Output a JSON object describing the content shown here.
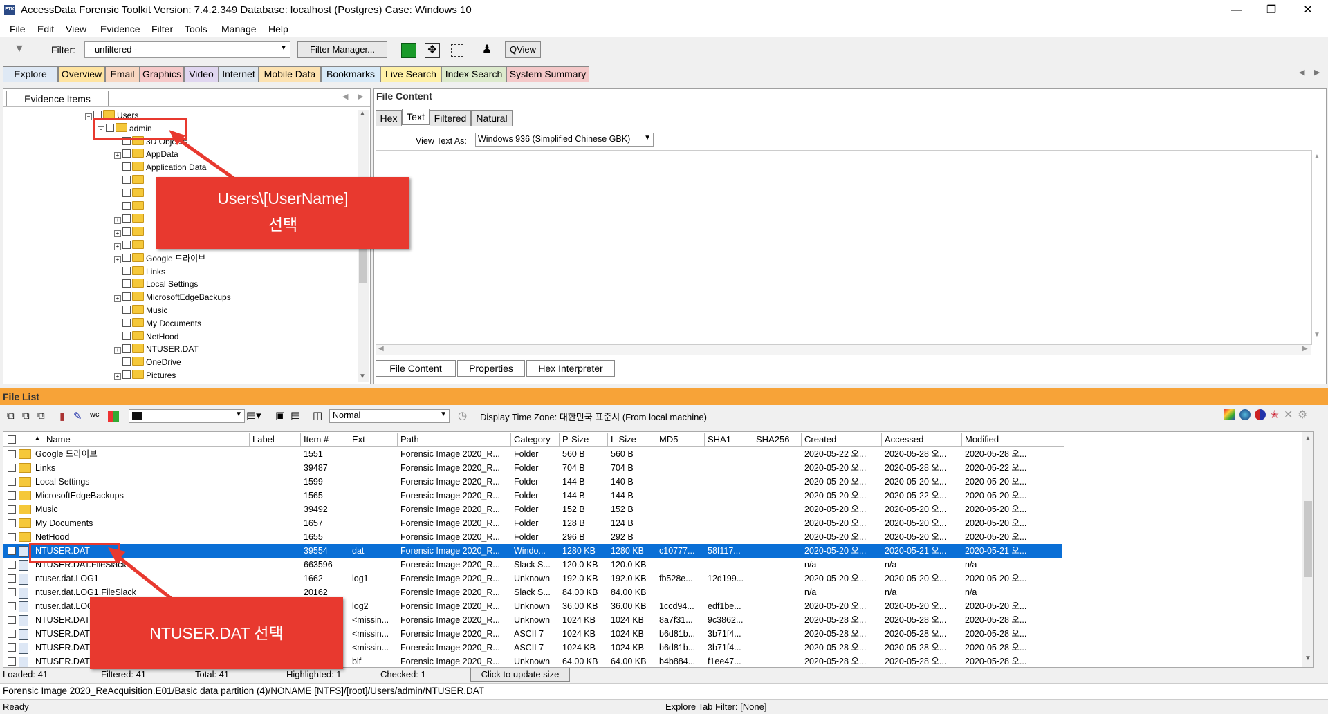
{
  "window": {
    "title": "AccessData Forensic Toolkit Version: 7.4.2.349 Database: localhost (Postgres) Case: Windows 10",
    "icon_text": "FTK"
  },
  "menu": [
    "File",
    "Edit",
    "View",
    "Evidence",
    "Filter",
    "Tools",
    "Manage",
    "Help"
  ],
  "toolbar": {
    "filter_label": "Filter:",
    "filter_value": "- unfiltered -",
    "filter_manager": "Filter Manager...",
    "qview": "QView"
  },
  "main_tabs": [
    "Explore",
    "Overview",
    "Email",
    "Graphics",
    "Video",
    "Internet",
    "Mobile Data",
    "Bookmarks",
    "Live Search",
    "Index Search",
    "System Summary"
  ],
  "evidence": {
    "tab": "Evidence Items",
    "tree": [
      {
        "label": "Users",
        "indent": 0,
        "exp": "−"
      },
      {
        "label": "admin",
        "indent": 1,
        "exp": "−"
      },
      {
        "label": "3D Objects",
        "indent": 2,
        "exp": ""
      },
      {
        "label": "AppData",
        "indent": 2,
        "exp": "+"
      },
      {
        "label": "Application Data",
        "indent": 2,
        "exp": ""
      },
      {
        "label": "",
        "indent": 2,
        "exp": ""
      },
      {
        "label": "",
        "indent": 2,
        "exp": ""
      },
      {
        "label": "",
        "indent": 2,
        "exp": ""
      },
      {
        "label": "",
        "indent": 2,
        "exp": "+"
      },
      {
        "label": "",
        "indent": 2,
        "exp": "+"
      },
      {
        "label": "",
        "indent": 2,
        "exp": "+"
      },
      {
        "label": "Google 드라이브",
        "indent": 2,
        "exp": "+"
      },
      {
        "label": "Links",
        "indent": 2,
        "exp": ""
      },
      {
        "label": "Local Settings",
        "indent": 2,
        "exp": ""
      },
      {
        "label": "MicrosoftEdgeBackups",
        "indent": 2,
        "exp": "+"
      },
      {
        "label": "Music",
        "indent": 2,
        "exp": ""
      },
      {
        "label": "My Documents",
        "indent": 2,
        "exp": ""
      },
      {
        "label": "NetHood",
        "indent": 2,
        "exp": ""
      },
      {
        "label": "NTUSER.DAT",
        "indent": 2,
        "exp": "+"
      },
      {
        "label": "OneDrive",
        "indent": 2,
        "exp": ""
      },
      {
        "label": "Pictures",
        "indent": 2,
        "exp": "+"
      }
    ]
  },
  "content": {
    "title": "File Content",
    "tabs": [
      "Hex",
      "Text",
      "Filtered",
      "Natural"
    ],
    "view_text_label": "View Text As:",
    "view_text_value": "Windows 936 (Simplified Chinese GBK)",
    "bottom_tabs": [
      "File Content",
      "Properties",
      "Hex Interpreter"
    ]
  },
  "filelist": {
    "title": "File List",
    "view_value": "Normal",
    "timezone": "Display Time Zone: 대한민국 표준시  (From local machine)",
    "columns": [
      "Name",
      "Label",
      "Item #",
      "Ext",
      "Path",
      "Category",
      "P-Size",
      "L-Size",
      "MD5",
      "SHA1",
      "SHA256",
      "Created",
      "Accessed",
      "Modified"
    ],
    "rows": [
      [
        "Google 드라이브",
        "",
        "1551",
        "",
        "Forensic Image 2020_R...",
        "Folder",
        "560 B",
        "560 B",
        "",
        "",
        "",
        "2020-05-22 오...",
        "2020-05-28 오...",
        "2020-05-28 오..."
      ],
      [
        "Links",
        "",
        "39487",
        "",
        "Forensic Image 2020_R...",
        "Folder",
        "704 B",
        "704 B",
        "",
        "",
        "",
        "2020-05-20 오...",
        "2020-05-28 오...",
        "2020-05-22 오..."
      ],
      [
        "Local Settings",
        "",
        "1599",
        "",
        "Forensic Image 2020_R...",
        "Folder",
        "144 B",
        "140 B",
        "",
        "",
        "",
        "2020-05-20 오...",
        "2020-05-20 오...",
        "2020-05-20 오..."
      ],
      [
        "MicrosoftEdgeBackups",
        "",
        "1565",
        "",
        "Forensic Image 2020_R...",
        "Folder",
        "144 B",
        "144 B",
        "",
        "",
        "",
        "2020-05-20 오...",
        "2020-05-22 오...",
        "2020-05-20 오..."
      ],
      [
        "Music",
        "",
        "39492",
        "",
        "Forensic Image 2020_R...",
        "Folder",
        "152 B",
        "152 B",
        "",
        "",
        "",
        "2020-05-20 오...",
        "2020-05-20 오...",
        "2020-05-20 오..."
      ],
      [
        "My Documents",
        "",
        "1657",
        "",
        "Forensic Image 2020_R...",
        "Folder",
        "128 B",
        "124 B",
        "",
        "",
        "",
        "2020-05-20 오...",
        "2020-05-20 오...",
        "2020-05-20 오..."
      ],
      [
        "NetHood",
        "",
        "1655",
        "",
        "Forensic Image 2020_R...",
        "Folder",
        "296 B",
        "292 B",
        "",
        "",
        "",
        "2020-05-20 오...",
        "2020-05-20 오...",
        "2020-05-20 오..."
      ],
      [
        "NTUSER.DAT",
        "",
        "39554",
        "dat",
        "Forensic Image 2020_R...",
        "Windo...",
        "1280 KB",
        "1280 KB",
        "c10777...",
        "58f117...",
        "",
        "2020-05-20 오...",
        "2020-05-21 오...",
        "2020-05-21 오..."
      ],
      [
        "NTUSER.DAT.FileSlack",
        "",
        "663596",
        "",
        "Forensic Image 2020_R...",
        "Slack S...",
        "120.0 KB",
        "120.0 KB",
        "",
        "",
        "",
        "n/a",
        "n/a",
        "n/a"
      ],
      [
        "ntuser.dat.LOG1",
        "",
        "1662",
        "log1",
        "Forensic Image 2020_R...",
        "Unknown",
        "192.0 KB",
        "192.0 KB",
        "fb528e...",
        "12d199...",
        "",
        "2020-05-20 오...",
        "2020-05-20 오...",
        "2020-05-20 오..."
      ],
      [
        "ntuser.dat.LOG1.FileSlack",
        "",
        "20162",
        "",
        "Forensic Image 2020_R...",
        "Slack S...",
        "84.00 KB",
        "84.00 KB",
        "",
        "",
        "",
        "n/a",
        "n/a",
        "n/a"
      ],
      [
        "ntuser.dat.LOG2",
        "",
        "",
        "log2",
        "Forensic Image 2020_R...",
        "Unknown",
        "36.00 KB",
        "36.00 KB",
        "1ccd94...",
        "edf1be...",
        "",
        "2020-05-20 오...",
        "2020-05-20 오...",
        "2020-05-20 오..."
      ],
      [
        "NTUSER.DAT",
        "",
        "",
        "<missin...",
        "Forensic Image 2020_R...",
        "Unknown",
        "1024 KB",
        "1024 KB",
        "8a7f31...",
        "9c3862...",
        "",
        "2020-05-28 오...",
        "2020-05-28 오...",
        "2020-05-28 오..."
      ],
      [
        "NTUSER.DAT",
        "",
        "",
        "<missin...",
        "Forensic Image 2020_R...",
        "ASCII 7",
        "1024 KB",
        "1024 KB",
        "b6d81b...",
        "3b71f4...",
        "",
        "2020-05-28 오...",
        "2020-05-28 오...",
        "2020-05-28 오..."
      ],
      [
        "NTUSER.DAT",
        "",
        "",
        "<missin...",
        "Forensic Image 2020_R...",
        "ASCII 7",
        "1024 KB",
        "1024 KB",
        "b6d81b...",
        "3b71f4...",
        "",
        "2020-05-28 오...",
        "2020-05-28 오...",
        "2020-05-28 오..."
      ],
      [
        "NTUSER.DAT",
        "",
        "",
        "blf",
        "Forensic Image 2020_R...",
        "Unknown",
        "64.00 KB",
        "64.00 KB",
        "b4b884...",
        "f1ee47...",
        "",
        "2020-05-28 오...",
        "2020-05-28 오...",
        "2020-05-28 오..."
      ]
    ]
  },
  "statusbar": {
    "loaded": "Loaded: 41",
    "filtered": "Filtered: 41",
    "total": "Total: 41",
    "highlighted": "Highlighted: 1",
    "checked": "Checked: 1",
    "update": "Click to update size",
    "path": "Forensic Image 2020_ReAcquisition.E01/Basic data partition (4)/NONAME [NTFS]/[root]/Users/admin/NTUSER.DAT",
    "ready": "Ready",
    "explore_filter": "Explore Tab Filter: [None]"
  },
  "callouts": {
    "users": "Users\\[UserName]\n선택",
    "ntuser": "NTUSER.DAT 선택"
  },
  "colors": {
    "accent_orange": "#f7a338",
    "selection": "#0a6fd6",
    "callout_red": "#e8392f"
  }
}
